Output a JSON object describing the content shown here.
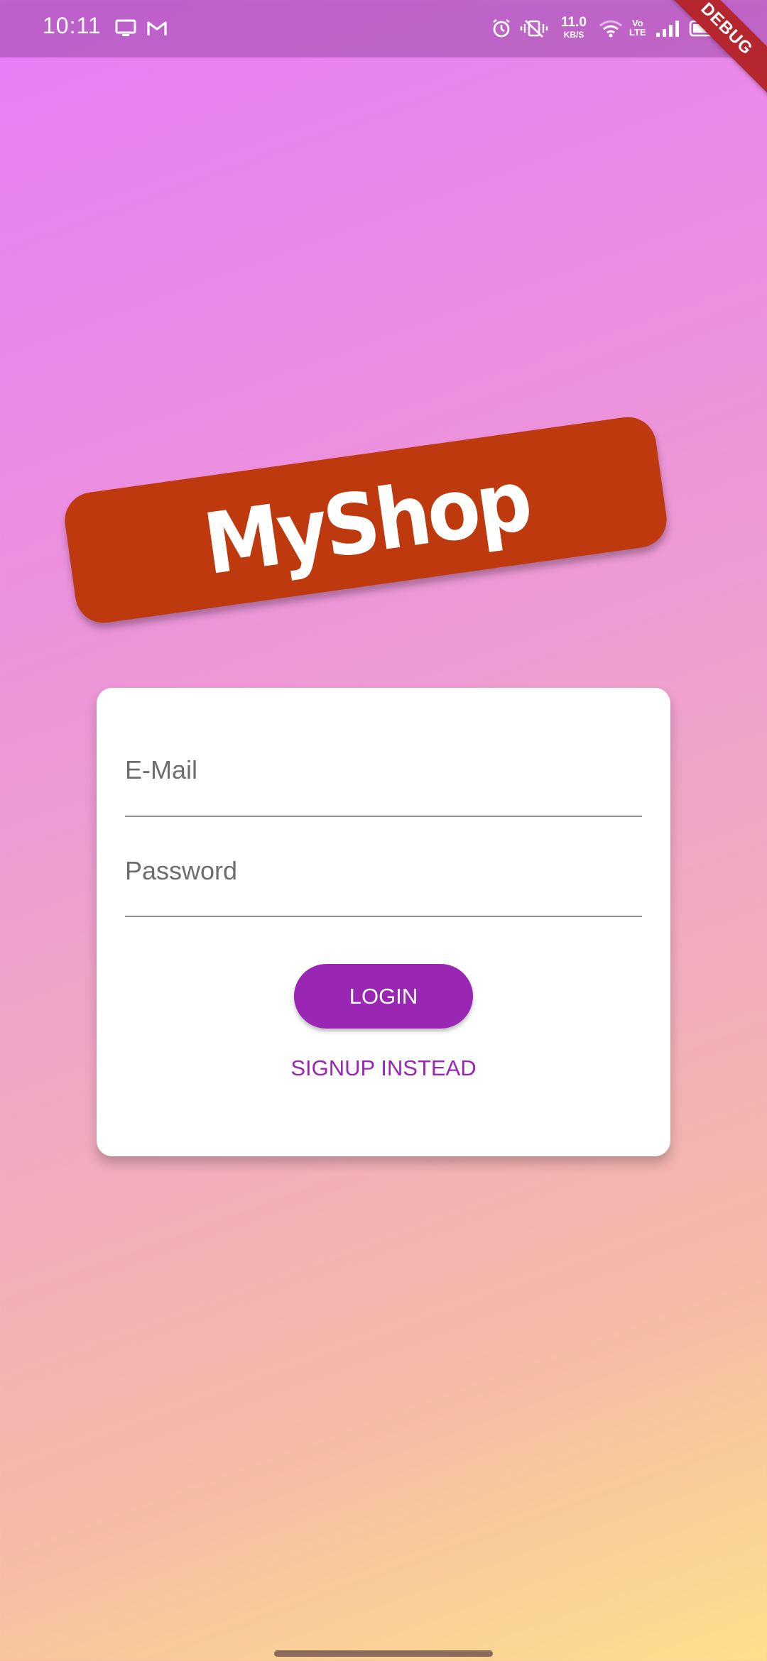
{
  "status_bar": {
    "time": "10:11",
    "net_speed_value": "11.0",
    "net_speed_unit": "KB/S",
    "volte_line1": "Vo",
    "volte_line2": "LTE",
    "icons": [
      "monitor-icon",
      "gmail-icon",
      "alarm-icon",
      "vibrate-icon",
      "wifi-icon",
      "signal-icon",
      "battery-icon"
    ]
  },
  "debug_banner": "DEBUG",
  "logo": {
    "text": "MyShop",
    "color": "#be3a0e"
  },
  "form": {
    "email_placeholder": "E-Mail",
    "password_placeholder": "Password",
    "login_label": "LOGIN",
    "signup_label": "SIGNUP INSTEAD"
  },
  "colors": {
    "accent": "#9a27b3",
    "card": "#ffffff"
  }
}
